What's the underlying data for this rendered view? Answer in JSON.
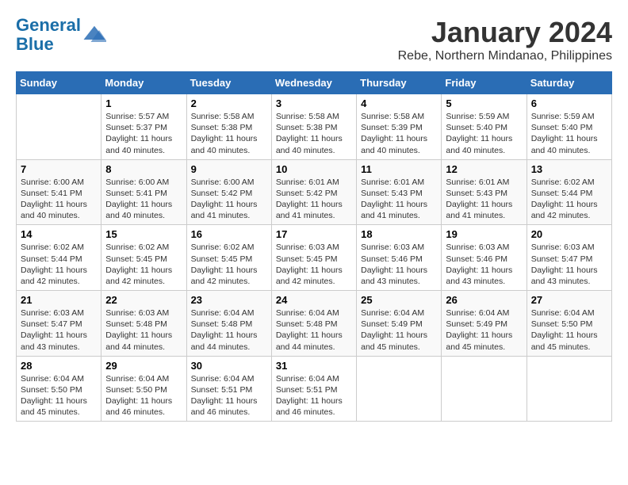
{
  "header": {
    "logo_line1": "General",
    "logo_line2": "Blue",
    "month": "January 2024",
    "location": "Rebe, Northern Mindanao, Philippines"
  },
  "columns": [
    "Sunday",
    "Monday",
    "Tuesday",
    "Wednesday",
    "Thursday",
    "Friday",
    "Saturday"
  ],
  "weeks": [
    [
      {
        "day": "",
        "info": ""
      },
      {
        "day": "1",
        "info": "Sunrise: 5:57 AM\nSunset: 5:37 PM\nDaylight: 11 hours\nand 40 minutes."
      },
      {
        "day": "2",
        "info": "Sunrise: 5:58 AM\nSunset: 5:38 PM\nDaylight: 11 hours\nand 40 minutes."
      },
      {
        "day": "3",
        "info": "Sunrise: 5:58 AM\nSunset: 5:38 PM\nDaylight: 11 hours\nand 40 minutes."
      },
      {
        "day": "4",
        "info": "Sunrise: 5:58 AM\nSunset: 5:39 PM\nDaylight: 11 hours\nand 40 minutes."
      },
      {
        "day": "5",
        "info": "Sunrise: 5:59 AM\nSunset: 5:40 PM\nDaylight: 11 hours\nand 40 minutes."
      },
      {
        "day": "6",
        "info": "Sunrise: 5:59 AM\nSunset: 5:40 PM\nDaylight: 11 hours\nand 40 minutes."
      }
    ],
    [
      {
        "day": "7",
        "info": "Sunrise: 6:00 AM\nSunset: 5:41 PM\nDaylight: 11 hours\nand 40 minutes."
      },
      {
        "day": "8",
        "info": "Sunrise: 6:00 AM\nSunset: 5:41 PM\nDaylight: 11 hours\nand 40 minutes."
      },
      {
        "day": "9",
        "info": "Sunrise: 6:00 AM\nSunset: 5:42 PM\nDaylight: 11 hours\nand 41 minutes."
      },
      {
        "day": "10",
        "info": "Sunrise: 6:01 AM\nSunset: 5:42 PM\nDaylight: 11 hours\nand 41 minutes."
      },
      {
        "day": "11",
        "info": "Sunrise: 6:01 AM\nSunset: 5:43 PM\nDaylight: 11 hours\nand 41 minutes."
      },
      {
        "day": "12",
        "info": "Sunrise: 6:01 AM\nSunset: 5:43 PM\nDaylight: 11 hours\nand 41 minutes."
      },
      {
        "day": "13",
        "info": "Sunrise: 6:02 AM\nSunset: 5:44 PM\nDaylight: 11 hours\nand 42 minutes."
      }
    ],
    [
      {
        "day": "14",
        "info": "Sunrise: 6:02 AM\nSunset: 5:44 PM\nDaylight: 11 hours\nand 42 minutes."
      },
      {
        "day": "15",
        "info": "Sunrise: 6:02 AM\nSunset: 5:45 PM\nDaylight: 11 hours\nand 42 minutes."
      },
      {
        "day": "16",
        "info": "Sunrise: 6:02 AM\nSunset: 5:45 PM\nDaylight: 11 hours\nand 42 minutes."
      },
      {
        "day": "17",
        "info": "Sunrise: 6:03 AM\nSunset: 5:45 PM\nDaylight: 11 hours\nand 42 minutes."
      },
      {
        "day": "18",
        "info": "Sunrise: 6:03 AM\nSunset: 5:46 PM\nDaylight: 11 hours\nand 43 minutes."
      },
      {
        "day": "19",
        "info": "Sunrise: 6:03 AM\nSunset: 5:46 PM\nDaylight: 11 hours\nand 43 minutes."
      },
      {
        "day": "20",
        "info": "Sunrise: 6:03 AM\nSunset: 5:47 PM\nDaylight: 11 hours\nand 43 minutes."
      }
    ],
    [
      {
        "day": "21",
        "info": "Sunrise: 6:03 AM\nSunset: 5:47 PM\nDaylight: 11 hours\nand 43 minutes."
      },
      {
        "day": "22",
        "info": "Sunrise: 6:03 AM\nSunset: 5:48 PM\nDaylight: 11 hours\nand 44 minutes."
      },
      {
        "day": "23",
        "info": "Sunrise: 6:04 AM\nSunset: 5:48 PM\nDaylight: 11 hours\nand 44 minutes."
      },
      {
        "day": "24",
        "info": "Sunrise: 6:04 AM\nSunset: 5:48 PM\nDaylight: 11 hours\nand 44 minutes."
      },
      {
        "day": "25",
        "info": "Sunrise: 6:04 AM\nSunset: 5:49 PM\nDaylight: 11 hours\nand 45 minutes."
      },
      {
        "day": "26",
        "info": "Sunrise: 6:04 AM\nSunset: 5:49 PM\nDaylight: 11 hours\nand 45 minutes."
      },
      {
        "day": "27",
        "info": "Sunrise: 6:04 AM\nSunset: 5:50 PM\nDaylight: 11 hours\nand 45 minutes."
      }
    ],
    [
      {
        "day": "28",
        "info": "Sunrise: 6:04 AM\nSunset: 5:50 PM\nDaylight: 11 hours\nand 45 minutes."
      },
      {
        "day": "29",
        "info": "Sunrise: 6:04 AM\nSunset: 5:50 PM\nDaylight: 11 hours\nand 46 minutes."
      },
      {
        "day": "30",
        "info": "Sunrise: 6:04 AM\nSunset: 5:51 PM\nDaylight: 11 hours\nand 46 minutes."
      },
      {
        "day": "31",
        "info": "Sunrise: 6:04 AM\nSunset: 5:51 PM\nDaylight: 11 hours\nand 46 minutes."
      },
      {
        "day": "",
        "info": ""
      },
      {
        "day": "",
        "info": ""
      },
      {
        "day": "",
        "info": ""
      }
    ]
  ]
}
